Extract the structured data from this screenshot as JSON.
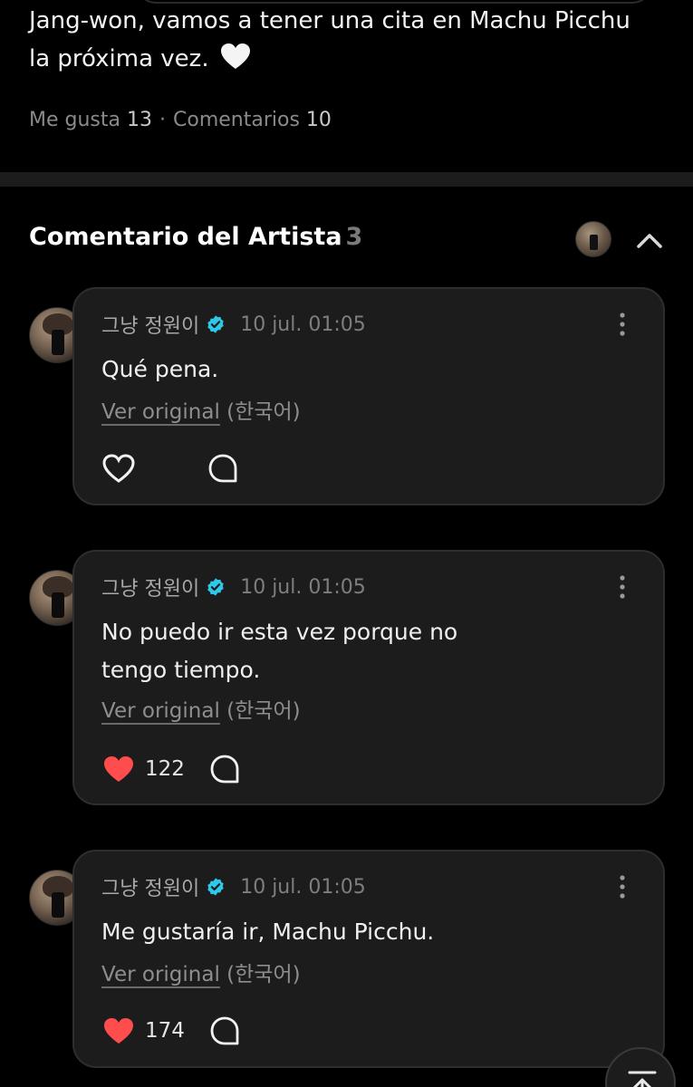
{
  "post": {
    "text_line1": "Jang-won, vamos a tener una cita en Machu Picchu",
    "text_line2": "la próxima vez.",
    "likes_label": "Me gusta",
    "likes_count": "13",
    "comments_label": "Comentarios",
    "comments_count": "10"
  },
  "artist_section": {
    "title": "Comentario del Artista",
    "count": "3"
  },
  "comments": [
    {
      "author": "그냥 정원이",
      "time": "10 jul. 01:05",
      "text": "Qué pena.",
      "translate_link": "Ver original",
      "translate_lang": "(한국어)",
      "likes": "",
      "liked": false
    },
    {
      "author": "그냥 정원이",
      "time": "10 jul. 01:05",
      "text": "No puedo ir esta vez porque no tengo tiempo.",
      "translate_link": "Ver original",
      "translate_lang": "(한국어)",
      "likes": "122",
      "liked": true
    },
    {
      "author": "그냥 정원이",
      "time": "10 jul. 01:05",
      "text": "Me gustaría ir, Machu Picchu.",
      "translate_link": "Ver original",
      "translate_lang": "(한국어)",
      "likes": "174",
      "liked": true
    }
  ],
  "colors": {
    "background": "#000000",
    "card": "#1c1c1c",
    "verified": "#2ec8e8",
    "liked_heart": "#ff4d4d"
  },
  "icons": [
    "white-heart-emoji",
    "chevron-up-icon",
    "verified-badge-icon",
    "more-vertical-icon",
    "heart-icon",
    "comment-bubble-icon",
    "scroll-to-top-icon"
  ]
}
